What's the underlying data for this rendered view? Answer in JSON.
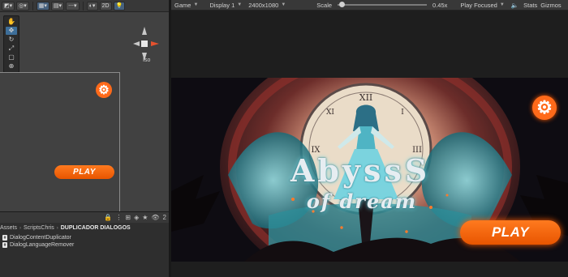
{
  "scene": {
    "toolbar": {
      "toggle_2d_label": "2D"
    },
    "tools": [
      "hand-tool",
      "move-tool",
      "rotate-tool",
      "scale-tool",
      "rect-tool",
      "transform-tool"
    ],
    "gizmo": {
      "projection_label": "Iso"
    },
    "play_label": "PLAY"
  },
  "project": {
    "badge_count": "2",
    "breadcrumb": [
      "Assets",
      "ScriptsChris",
      "DUPLICADOR DIALOGOS"
    ],
    "files": [
      {
        "name": "DialogContentDuplicator"
      },
      {
        "name": "DialogLanguageRemover"
      }
    ]
  },
  "game": {
    "toolbar": {
      "view_label": "Game",
      "display_label": "Display 1",
      "resolution_label": "2400x1080",
      "scale_label": "Scale",
      "scale_value": "0.45x",
      "play_mode_label": "Play Focused",
      "stats_label": "Stats",
      "gizmos_label": "Gizmos"
    },
    "title": "AbyssS",
    "subtitle": "of dream",
    "play_label": "PLAY"
  },
  "colors": {
    "accent_orange": "#ff6a1a",
    "teal": "#3fb6c6",
    "unity_panel": "#383838"
  }
}
